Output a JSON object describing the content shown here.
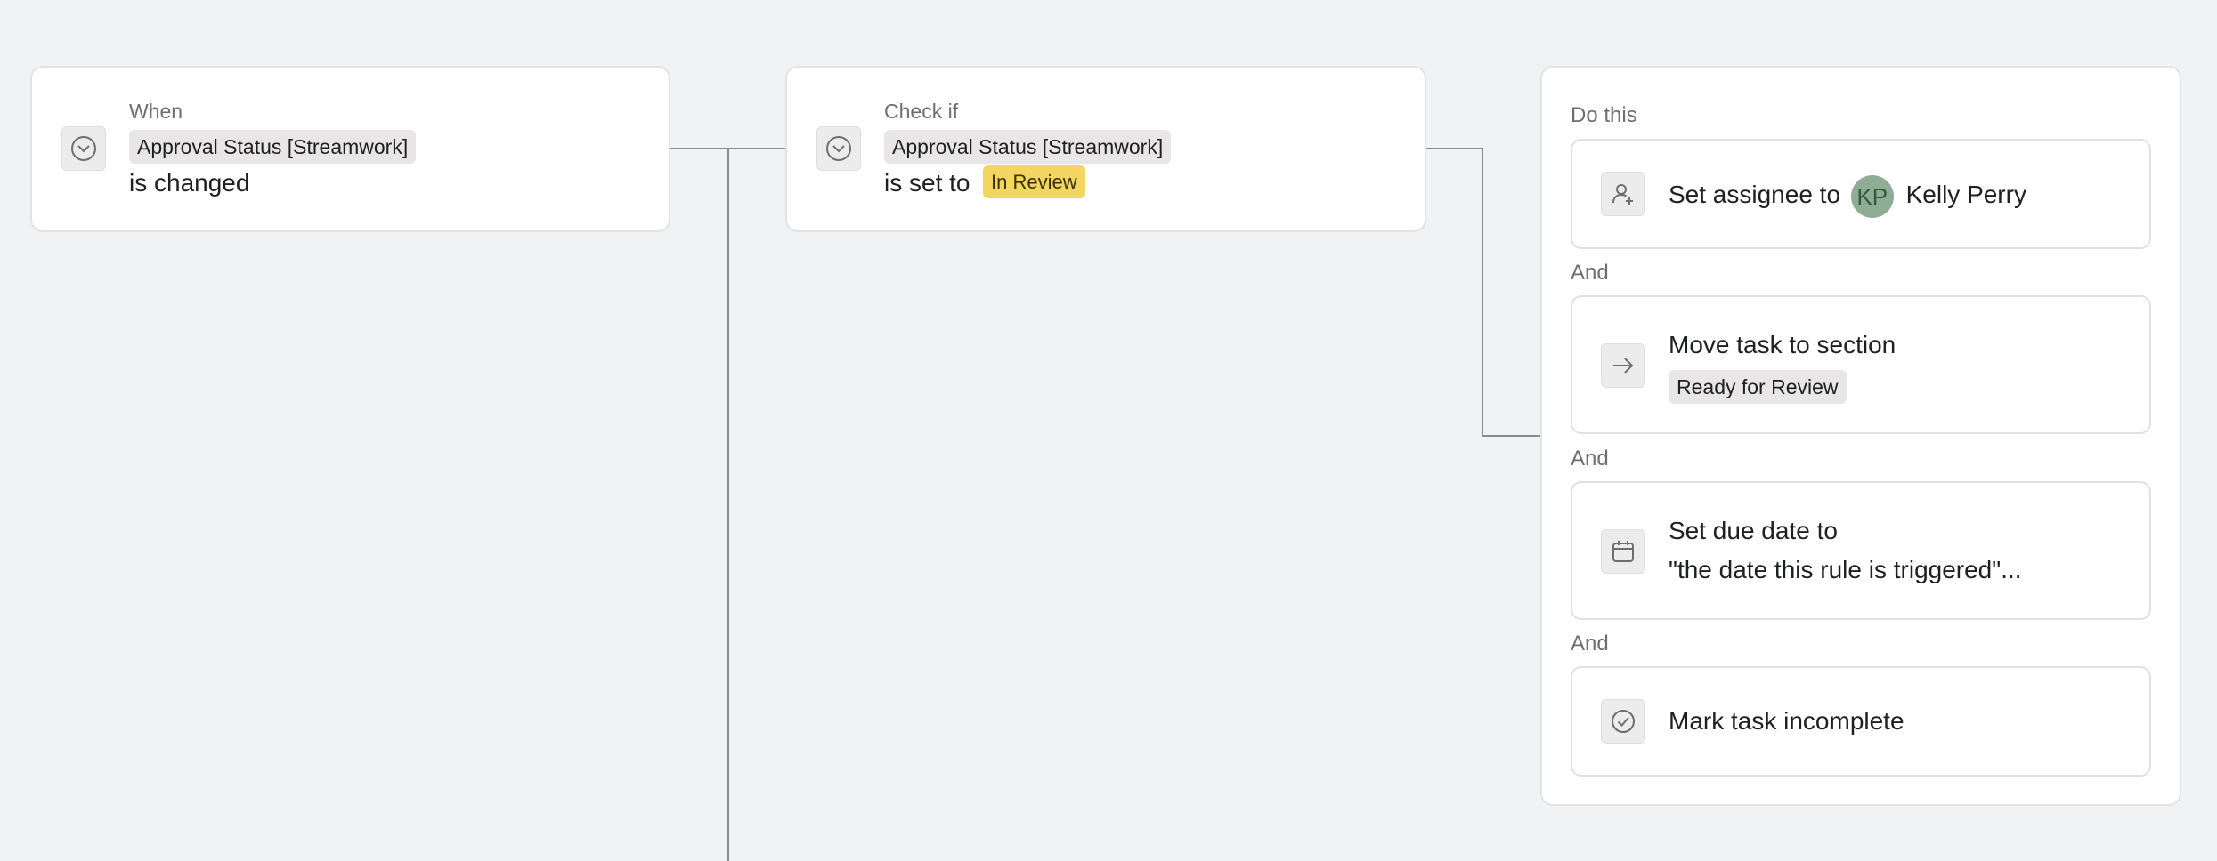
{
  "trigger": {
    "caption": "When",
    "field_chip": "Approval Status [Streamwork]",
    "condition": "is changed",
    "icon": "chevron-down-circle-icon"
  },
  "check": {
    "caption": "Check if",
    "field_chip": "Approval Status [Streamwork]",
    "condition_prefix": "is set to",
    "value_chip": "In Review",
    "value_color": "#f2d660",
    "icon": "chevron-down-circle-icon"
  },
  "actions": {
    "caption": "Do this",
    "and_label": "And",
    "items": [
      {
        "icon": "user-add-icon",
        "label": "Set assignee to",
        "avatar_initials": "KP",
        "assignee": "Kelly Perry"
      },
      {
        "icon": "arrow-right-icon",
        "label": "Move task to section",
        "section_chip": "Ready for Review"
      },
      {
        "icon": "calendar-icon",
        "label": "Set due date to",
        "detail": "\"the date this rule is triggered\"..."
      },
      {
        "icon": "check-circle-icon",
        "label": "Mark task incomplete"
      }
    ]
  }
}
